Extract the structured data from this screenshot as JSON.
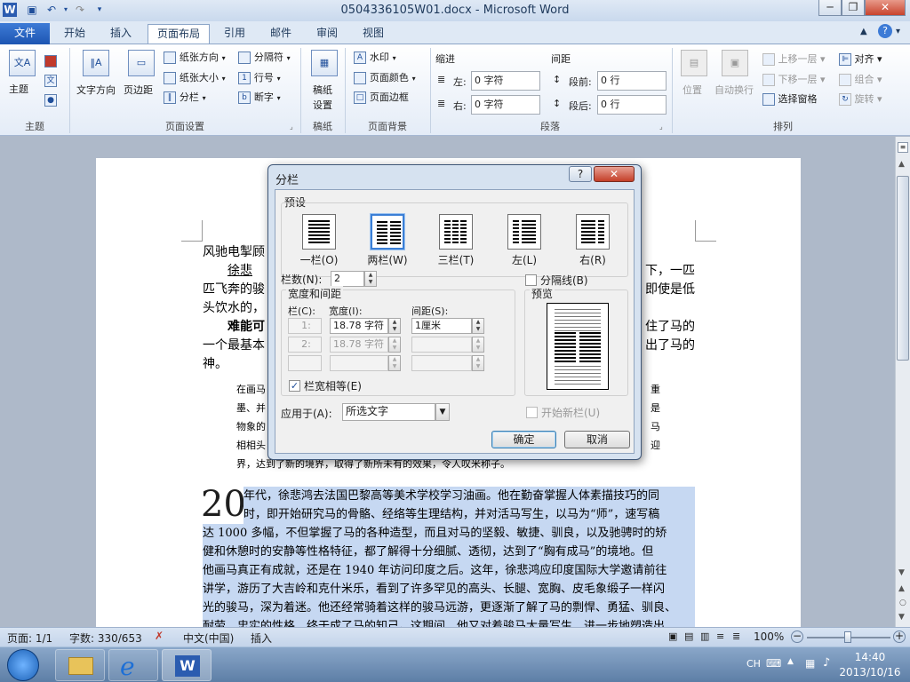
{
  "titlebar": {
    "title": "0504336105W01.docx - Microsoft Word",
    "app_icon": "W",
    "min": "─",
    "max": "❐",
    "close": "✕"
  },
  "tabs": [
    {
      "label": "文件"
    },
    {
      "label": "开始"
    },
    {
      "label": "插入"
    },
    {
      "label": "页面布局"
    },
    {
      "label": "引用"
    },
    {
      "label": "邮件"
    },
    {
      "label": "审阅"
    },
    {
      "label": "视图"
    }
  ],
  "ribbon": {
    "groups": {
      "theme": "主题",
      "pagesetup": "页面设置",
      "manuscript": "稿纸",
      "pagebg": "页面背景",
      "paragraph": "段落",
      "arrange": "排列"
    },
    "theme": {
      "themes": "主题"
    },
    "pagesetup": {
      "textdir": "文字方向",
      "margins": "页边距",
      "orientation": "纸张方向",
      "size": "纸张大小",
      "columns": "分栏",
      "breaks": "分隔符",
      "linenum": "行号",
      "hyphen": "断字"
    },
    "manuscript": {
      "setup1": "稿纸",
      "setup2": "设置"
    },
    "pagebg": {
      "watermark": "水印",
      "color": "页面颜色",
      "border": "页面边框"
    },
    "paragraph": {
      "indent": "缩进",
      "spacing": "间距",
      "left": "左:",
      "right": "右:",
      "before": "段前:",
      "after": "段后:",
      "left_val": "0 字符",
      "right_val": "0 字符",
      "before_val": "0 行",
      "after_val": "0 行"
    },
    "arrange": {
      "position": "位置",
      "wrap": "自动换行",
      "forward": "上移一层",
      "backward": "下移一层",
      "pane": "选择窗格",
      "align": "对齐",
      "group": "组合",
      "rotate": "旋转"
    }
  },
  "document": {
    "line1": "风驰电掣顾",
    "line2a": "徐悲",
    "line2b": "下，一匹",
    "line3a": "匹飞奔的骏",
    "line3b": "即使是低",
    "line4": "头饮水的，",
    "line5a": "难能可",
    "line5b": "住了马的",
    "line6a": "一个最基本",
    "line6b": "出了马的",
    "line7": "神。",
    "small": [
      "在画马",
      "重",
      "墨、并",
      "是",
      "物象的",
      "马",
      "相相头",
      "迎",
      "界，达到了新的境界，取得了新所未有的效果，令人叹米称子。"
    ],
    "dropcap": "20",
    "sel_lines": [
      "年代，徐悲鸿去法国巴黎高等美术学校学习油画。他在勤奋掌握人体素描技巧的同",
      "时，即开始研究马的骨骼、经络等生理结构，并对活马写生，以马为“师”，速写稿",
      "达 1000 多幅，不但掌握了马的各种造型，而且对马的坚毅、敏捷、驯良，以及驰骋时的矫",
      "健和休憩时的安静等性格特征，都了解得十分细腻、透彻，达到了“胸有成马”的境地。但",
      "他画马真正有成就，还是在 1940 年访问印度之后。这年，徐悲鸿应印度国际大学邀请前往",
      "讲学，游历了大吉岭和克什米乐，看到了许多罕见的高头、长腿、宽胸、皮毛象缎子一样闪",
      "光的骏马，深为着迷。他还经常骑着这样的骏马远游，更逐渐了解了马的剽悍、勇猛、驯良、",
      "耐劳、忠实的性格，终于成了马的知己。这期间，他又对着骏马大量写生，进一步地塑造出"
    ]
  },
  "dialog": {
    "title": "分栏",
    "help": "?",
    "close": "✕",
    "presets_label": "预设",
    "presets": [
      {
        "label": "一栏(O)"
      },
      {
        "label": "两栏(W)"
      },
      {
        "label": "三栏(T)"
      },
      {
        "label": "左(L)"
      },
      {
        "label": "右(R)"
      }
    ],
    "num_cols_label": "栏数(N):",
    "num_cols": "2",
    "line_between": "分隔线(B)",
    "width_spacing": "宽度和间距",
    "preview": "预览",
    "col_hdr": "栏(C):",
    "width_hdr": "宽度(I):",
    "spacing_hdr": "间距(S):",
    "rows": [
      {
        "col": "1:",
        "width": "18.78 字符",
        "spacing": "1厘米"
      },
      {
        "col": "2:",
        "width": "18.78 字符",
        "spacing": ""
      },
      {
        "col": "",
        "width": "",
        "spacing": ""
      }
    ],
    "equal_width": "栏宽相等(E)",
    "apply_to_label": "应用于(A):",
    "apply_to": "所选文字",
    "new_column": "开始新栏(U)",
    "ok": "确定",
    "cancel": "取消"
  },
  "statusbar": {
    "page": "页面: 1/1",
    "words": "字数: 330/653",
    "lang": "中文(中国)",
    "mode": "插入",
    "zoom": "100%"
  },
  "taskbar": {
    "lang": "CH",
    "time": "14:40",
    "date": "2013/10/16"
  }
}
